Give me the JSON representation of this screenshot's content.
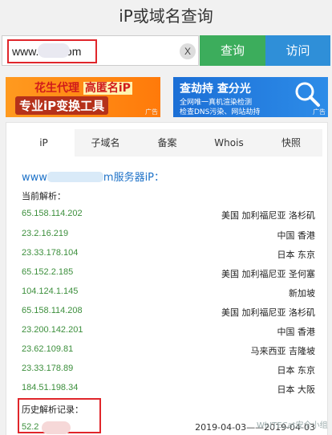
{
  "page_title": "iP或域名查询",
  "search": {
    "value": "www.la        e.com",
    "clear_glyph": "X",
    "query_label": "查询",
    "visit_label": "访问"
  },
  "ads": {
    "left": {
      "line1_a": "花生代理 ",
      "line1_b": "高匿名iP",
      "line2": "专业iP变换工具",
      "tag": "广告"
    },
    "right": {
      "line1": "查劫持 查分光",
      "line2": "全网唯一真机渲染检测",
      "line3": "检查DNS污染、网站劫持",
      "tag": "广告",
      "icon": "magnifier-icon"
    }
  },
  "tabs": [
    {
      "label": "iP"
    },
    {
      "label": "子域名"
    },
    {
      "label": "备案"
    },
    {
      "label": "Whois"
    },
    {
      "label": "快照"
    }
  ],
  "result": {
    "host_prefix": "www",
    "host_suffix": "m服务器iP：",
    "current_label": "当前解析：",
    "records": [
      {
        "ip": "65.158.114.202",
        "location": "美国 加利福尼亚 洛杉矶"
      },
      {
        "ip": "23.2.16.219",
        "location": "中国 香港"
      },
      {
        "ip": "23.33.178.104",
        "location": "日本 东京"
      },
      {
        "ip": "65.152.2.185",
        "location": "美国 加利福尼亚 圣何塞"
      },
      {
        "ip": "104.124.1.145",
        "location": "新加坡"
      },
      {
        "ip": "65.158.114.208",
        "location": "美国 加利福尼亚 洛杉矶"
      },
      {
        "ip": "23.200.142.201",
        "location": "中国 香港"
      },
      {
        "ip": "23.62.109.81",
        "location": "马来西亚 吉隆坡"
      },
      {
        "ip": "23.33.178.89",
        "location": "日本 东京"
      },
      {
        "ip": "184.51.198.34",
        "location": "日本 大阪"
      }
    ],
    "history_label": "历史解析记录：",
    "history": [
      {
        "ip": "52.2        .128",
        "date": "2019-04-03——2019-04-03"
      }
    ]
  },
  "watermark": "WhITECat安全小组",
  "colors": {
    "query_button": "#3cad5c",
    "visit_button": "#2f8fd8",
    "ip_text": "#3c8f3c",
    "host_link": "#1e72c8",
    "highlight_border": "#e0262b"
  }
}
